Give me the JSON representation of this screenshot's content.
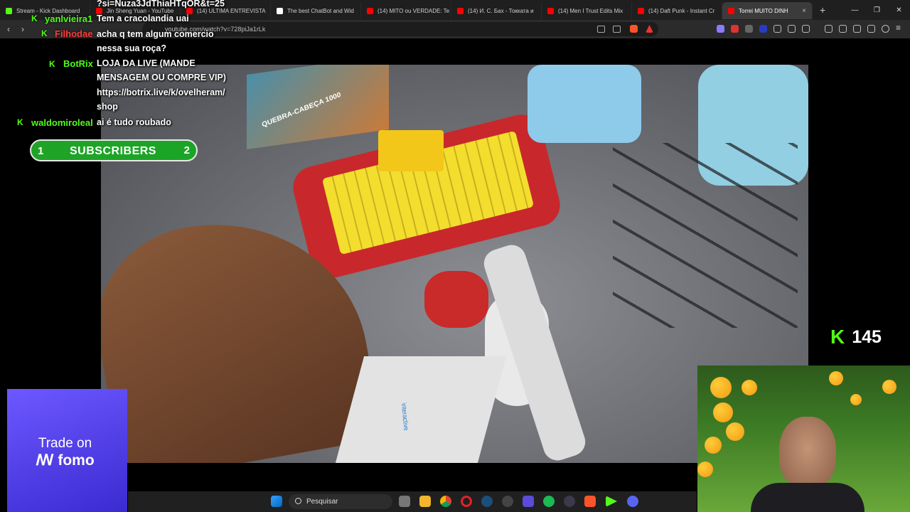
{
  "browser": {
    "tabs": [
      {
        "label": "Stream - Kick Dashboard",
        "color": "#53fc18"
      },
      {
        "label": "Jin Sheng Yuan - YouTube",
        "color": "#ff0000"
      },
      {
        "label": "(14) ULTIMA ENTREVISTA",
        "color": "#ff0000"
      },
      {
        "label": "The best ChatBot and Wid",
        "color": "#ffffff"
      },
      {
        "label": "(14) MITO ou VERDADE: Te",
        "color": "#ff0000"
      },
      {
        "label": "(14) И. С. Бах - Токката и",
        "color": "#ff0000"
      },
      {
        "label": "(14) Men I Trust Edits Mix",
        "color": "#ff0000"
      },
      {
        "label": "(14) Daft Punk - Instant Cr",
        "color": "#ff0000"
      },
      {
        "label": "Torrei MUITO DINH",
        "color": "#ff0000"
      }
    ],
    "active_close": "×",
    "new_tab": "+",
    "window_controls": [
      "—",
      "❐",
      "✕"
    ],
    "url": "youtube.com/watch?v=728piJa1rLk",
    "url_overflow_text": "?si=Nuza3JdThiaHTqOR&t=25"
  },
  "chat": {
    "lines": [
      {
        "user": "yanlvieira1",
        "user_color": "#53fc18",
        "badge": "K",
        "message": "Tem a cracolandia uai"
      },
      {
        "user": "Filhodae",
        "user_color": "#ff3b3b",
        "badge": "K",
        "message": "acha q tem algum comercio"
      },
      {
        "user": "",
        "user_color": "",
        "badge": "",
        "message": "nessa sua roça?"
      },
      {
        "user": "BotRix",
        "user_color": "#53fc18",
        "badge": "K",
        "message": "LOJA DA LIVE (MANDE"
      },
      {
        "user": "",
        "user_color": "",
        "badge": "",
        "message": "MENSAGEM OU COMPRE VIP)"
      },
      {
        "user": "",
        "user_color": "",
        "badge": "",
        "message": "https://botrix.live/k/ovelheram/"
      },
      {
        "user": "",
        "user_color": "",
        "badge": "",
        "message": "shop"
      },
      {
        "user": "waldomiroleal",
        "user_color": "#53fc18",
        "badge": "K",
        "message": "ai é tudo roubado"
      }
    ]
  },
  "subs_goal": {
    "current": "1",
    "label": "SUBSCRIBERS",
    "target": "2"
  },
  "viewers": {
    "badge": "K",
    "count": "145"
  },
  "ad": {
    "line1": "Trade on",
    "line2": "ꟿ fomo"
  },
  "video": {
    "box_text": "QUEBRA-CABEÇA 1000",
    "box_count": "1000",
    "device_label": "interactive"
  },
  "taskbar": {
    "search_placeholder": "Pesquisar",
    "apps": [
      "windows-start",
      "search",
      "task-view",
      "file-explorer",
      "chrome",
      "opera",
      "steam",
      "obs",
      "app-grid",
      "spotify",
      "app-misc",
      "brave",
      "kick",
      "discord"
    ]
  },
  "colors": {
    "kick_green": "#53fc18",
    "tab_bg": "#1f1f1f",
    "toolbar_bg": "#2b2b2b"
  }
}
